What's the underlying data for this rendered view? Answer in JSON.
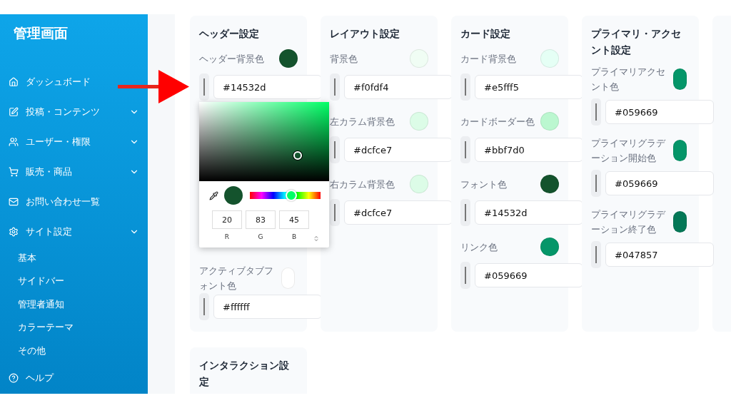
{
  "sidebar": {
    "title": "管理画面",
    "items": [
      {
        "label": "ダッシュボード",
        "kind": "link"
      },
      {
        "label": "投稿・コンテンツ",
        "kind": "group"
      },
      {
        "label": "ユーザー・権限",
        "kind": "group"
      },
      {
        "label": "販売・商品",
        "kind": "group"
      },
      {
        "label": "お問い合わせ一覧",
        "kind": "link"
      },
      {
        "label": "サイト設定",
        "kind": "group",
        "expanded": true,
        "children": [
          {
            "label": "基本"
          },
          {
            "label": "サイドバー"
          },
          {
            "label": "管理者通知"
          },
          {
            "label": "カラーテーマ"
          },
          {
            "label": "その他"
          }
        ]
      },
      {
        "label": "ヘルプ",
        "kind": "link"
      }
    ]
  },
  "cards": [
    {
      "title": "ヘッダー設定",
      "fields": [
        {
          "label": "ヘッダー背景色",
          "color": "#14532d",
          "kind": "circle",
          "value": "#14532d",
          "picker": {
            "color": "#14532d",
            "hue": {
              "level": 0.59
            },
            "channels": [
              {
                "label": "R",
                "value": "20"
              },
              {
                "label": "G",
                "value": "83"
              },
              {
                "label": "B",
                "value": "45"
              }
            ]
          }
        },
        {
          "label": "アクティブタブフォント色",
          "color": "#ffffff",
          "kind": "pill",
          "value": "#ffffff"
        }
      ]
    },
    {
      "title": "レイアウト設定",
      "fields": [
        {
          "label": "背景色",
          "color": "#f0fdf4",
          "kind": "circle",
          "value": "#f0fdf4"
        },
        {
          "label": "左カラム背景色",
          "color": "#dcfce7",
          "kind": "circle",
          "value": "#dcfce7"
        },
        {
          "label": "右カラム背景色",
          "color": "#dcfce7",
          "kind": "circle",
          "value": "#dcfce7"
        }
      ]
    },
    {
      "title": "カード設定",
      "fields": [
        {
          "label": "カード背景色",
          "color": "#e5fff5",
          "kind": "circle",
          "value": "#e5fff5"
        },
        {
          "label": "カードボーダー色",
          "color": "#bbf7d0",
          "kind": "circle",
          "value": "#bbf7d0"
        },
        {
          "label": "フォント色",
          "color": "#14532d",
          "kind": "circle",
          "value": "#14532d"
        },
        {
          "label": "リンク色",
          "color": "#059669",
          "kind": "circle",
          "value": "#059669"
        }
      ]
    },
    {
      "title": "プライマリ・アクセント設定",
      "fields": [
        {
          "label": "プライマリアクセント色",
          "color": "#059669",
          "kind": "pill",
          "value": "#059669"
        },
        {
          "label": "プライマリグラデーション開始色",
          "color": "#059669",
          "kind": "pill",
          "value": "#059669"
        },
        {
          "label": "プライマリグラデーション終了色",
          "color": "#047857",
          "kind": "pill",
          "value": "#047857"
        }
      ]
    },
    {
      "title": "インタラクション設定"
    }
  ]
}
